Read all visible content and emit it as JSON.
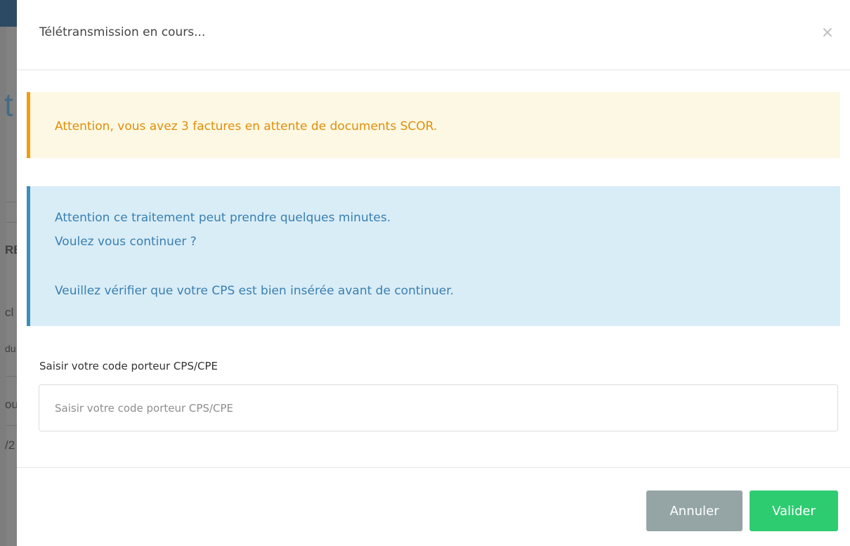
{
  "modal": {
    "title": "Télétransmission en cours...",
    "close_icon": "×"
  },
  "alerts": {
    "warning": "Attention, vous avez 3 factures en attente de documents SCOR.",
    "info": {
      "line1": "Attention ce traitement peut prendre quelques minutes.",
      "line2": "Voulez vous continuer ?",
      "line3": "Veuillez vérifier que votre CPS est bien insérée avant de continuer."
    }
  },
  "form": {
    "label": "Saisir votre code porteur CPS/CPE",
    "placeholder": "Saisir votre code porteur CPS/CPE",
    "value": ""
  },
  "footer": {
    "cancel_label": "Annuler",
    "validate_label": "Valider"
  },
  "colors": {
    "warning_border": "#f39c12",
    "warning_text": "#e08e0b",
    "info_border": "#3c8dbc",
    "cancel_button": "#95a5a6",
    "validate_button": "#2ecc71"
  },
  "background_fragments": [
    "t",
    "RE",
    "cl",
    "du",
    "ou",
    "/2"
  ]
}
